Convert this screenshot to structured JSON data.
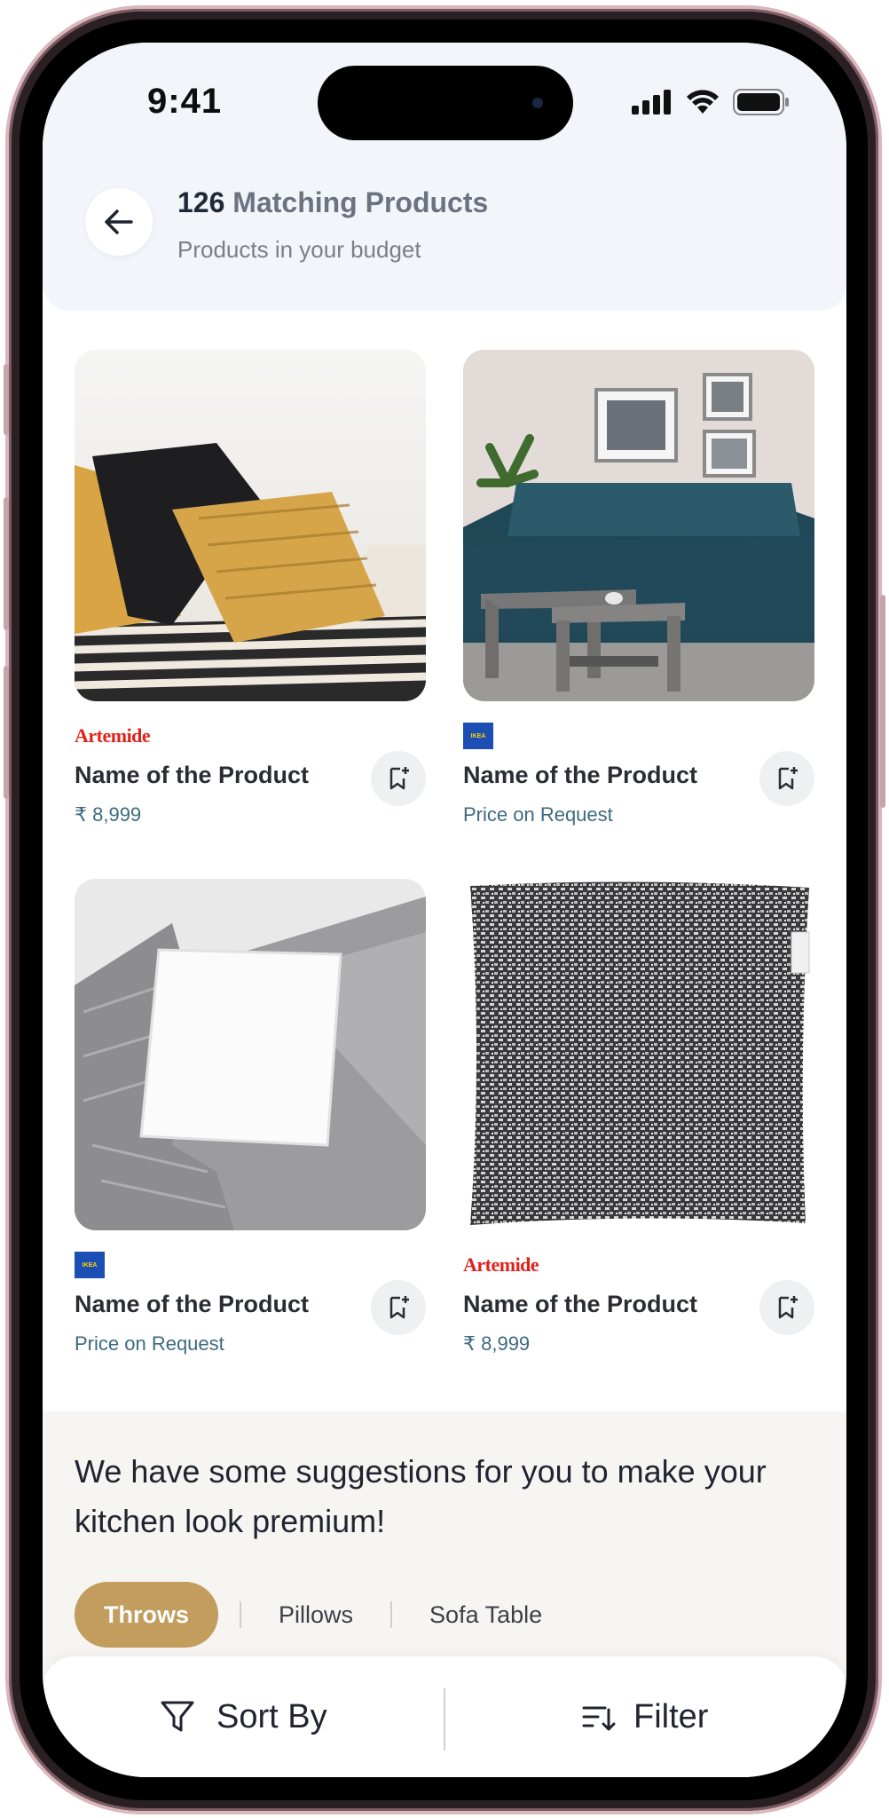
{
  "status_bar": {
    "time": "9:41"
  },
  "header": {
    "count": "126",
    "title": "Matching Products",
    "subtitle": "Products in your budget"
  },
  "products": [
    {
      "brand": "Artemide",
      "name": "Name of the Product",
      "price": "₹ 8,999"
    },
    {
      "brand": "IKEA",
      "name": "Name of the Product",
      "price": "Price on Request"
    },
    {
      "brand": "IKEA",
      "name": "Name of the Product",
      "price": "Price on Request"
    },
    {
      "brand": "Artemide",
      "name": "Name of the Product",
      "price": "₹ 8,999"
    }
  ],
  "suggestions": {
    "text": "We have some suggestions for you to make your kitchen look premium!",
    "chips": [
      "Throws",
      "Pillows",
      "Sofa Table"
    ],
    "active_chip": "Throws"
  },
  "bottom_bar": {
    "sort_label": "Sort By",
    "filter_label": "Filter"
  },
  "colors": {
    "accent": "#c29d5e",
    "price": "#3d6a7f",
    "header_bg": "#f2f6fa",
    "artemide_red": "#e0211a",
    "ikea_blue": "#1c4fb4"
  },
  "icons": [
    "back-arrow-icon",
    "cellular-signal-icon",
    "wifi-icon",
    "battery-icon",
    "bookmark-add-icon",
    "funnel-icon",
    "sort-filter-icon"
  ]
}
